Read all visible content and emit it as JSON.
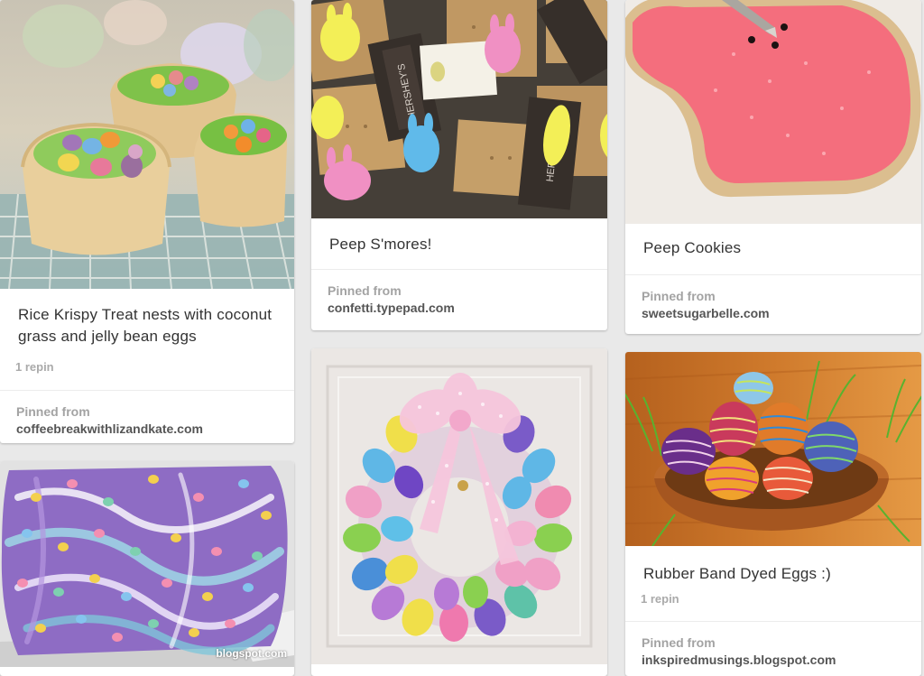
{
  "pins": [
    {
      "id": "rice-krispy",
      "description": "Rice Krispy Treat nests with coconut grass and jelly bean eggs",
      "repins": "1 repin",
      "source_label": "Pinned from",
      "source_domain": "coffeebreakwithlizandkate.com",
      "image": "rice krispy treat nests with jelly bean eggs"
    },
    {
      "id": "peep-smores",
      "description": "Peep S'mores!",
      "source_label": "Pinned from",
      "source_domain": "confetti.typepad.com",
      "image": "peeps and hershey's bars in bags"
    },
    {
      "id": "peep-cookies",
      "description": "Peep Cookies",
      "source_label": "Pinned from",
      "source_domain": "sweetsugarbelle.com",
      "image": "pink bunny sugar cookie"
    },
    {
      "id": "candy-bark",
      "image": "purple swirl candy bark with candy eggs",
      "watermark": "blogspot.com"
    },
    {
      "id": "egg-wreath",
      "image": "plastic easter egg wreath with pink bow"
    },
    {
      "id": "rubber-band-eggs",
      "description": "Rubber Band Dyed Eggs :)",
      "repins": "1 repin",
      "source_label": "Pinned from",
      "source_domain": "inkspiredmusings.blogspot.com",
      "image": "striped dyed eggs in a bowl"
    }
  ]
}
